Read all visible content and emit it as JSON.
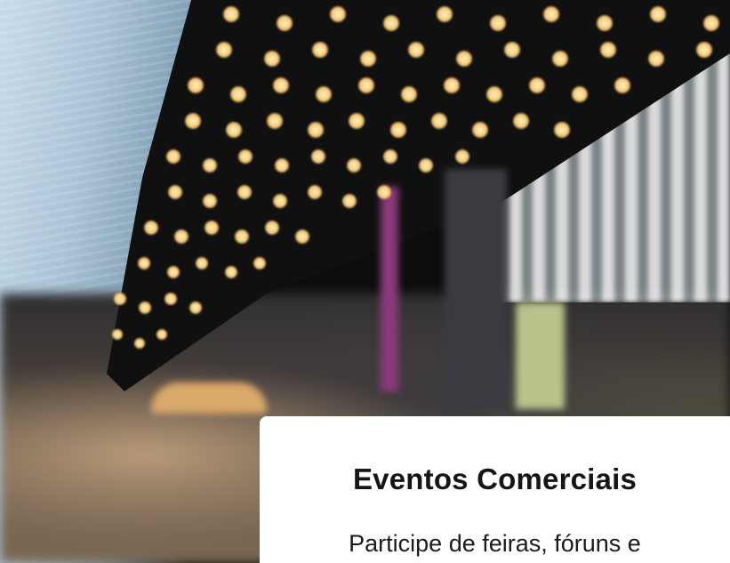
{
  "hero": {
    "image_description_icon": "exhibition-hall-photo-icon"
  },
  "card": {
    "title": "Eventos Comerciais",
    "text": "Participe de feiras, fóruns e"
  },
  "colors": {
    "card_background": "#ffffff",
    "title_color": "#151515",
    "text_color": "#1b1b1b"
  }
}
